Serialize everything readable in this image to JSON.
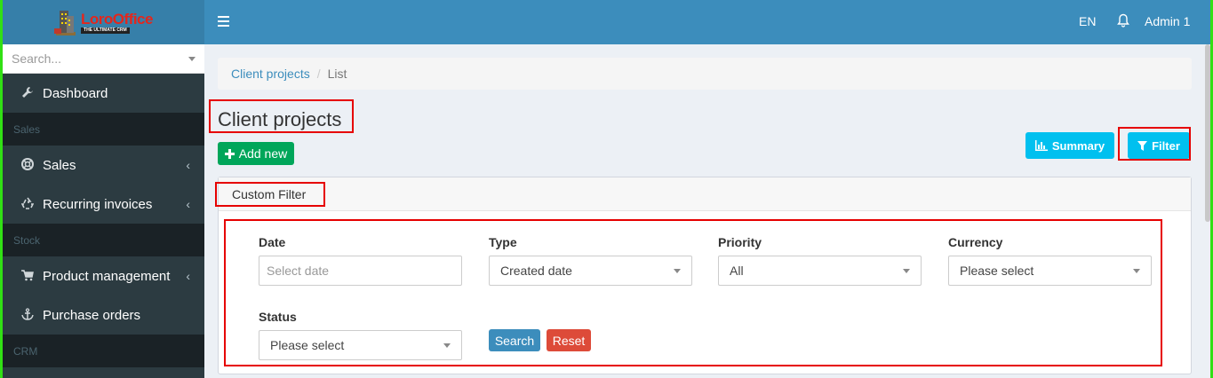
{
  "brand": {
    "name": "LoroOffice",
    "tagline": "THE ULTIMATE CRM"
  },
  "sidebar": {
    "search_placeholder": "Search...",
    "items": [
      {
        "label": "Dashboard",
        "icon": "wrench-icon",
        "type": "item"
      },
      {
        "label": "Sales",
        "type": "header"
      },
      {
        "label": "Sales",
        "icon": "life-ring-icon",
        "type": "item",
        "chevron": "‹"
      },
      {
        "label": "Recurring invoices",
        "icon": "recycle-icon",
        "type": "item",
        "chevron": "‹"
      },
      {
        "label": "Stock",
        "type": "header"
      },
      {
        "label": "Product management",
        "icon": "cart-icon",
        "type": "item",
        "chevron": "‹"
      },
      {
        "label": "Purchase orders",
        "icon": "anchor-icon",
        "type": "item"
      },
      {
        "label": "CRM",
        "type": "header"
      }
    ]
  },
  "topbar": {
    "language": "EN",
    "user": "Admin 1"
  },
  "breadcrumb": {
    "link": "Client projects",
    "current": "List"
  },
  "page": {
    "title": "Client projects",
    "add_label": "Add new",
    "summary_label": "Summary",
    "filter_label": "Filter"
  },
  "filter": {
    "title": "Custom Filter",
    "date_label": "Date",
    "date_placeholder": "Select date",
    "type_label": "Type",
    "type_value": "Created date",
    "priority_label": "Priority",
    "priority_value": "All",
    "currency_label": "Currency",
    "currency_value": "Please select",
    "status_label": "Status",
    "status_value": "Please select",
    "search_label": "Search",
    "reset_label": "Reset"
  },
  "colors": {
    "topbar": "#3c8dbc",
    "sidebar": "#222d32",
    "add_button": "#00a65a",
    "info_button": "#00c0ef",
    "reset_button": "#dd4b39",
    "highlight": "#e60000"
  }
}
